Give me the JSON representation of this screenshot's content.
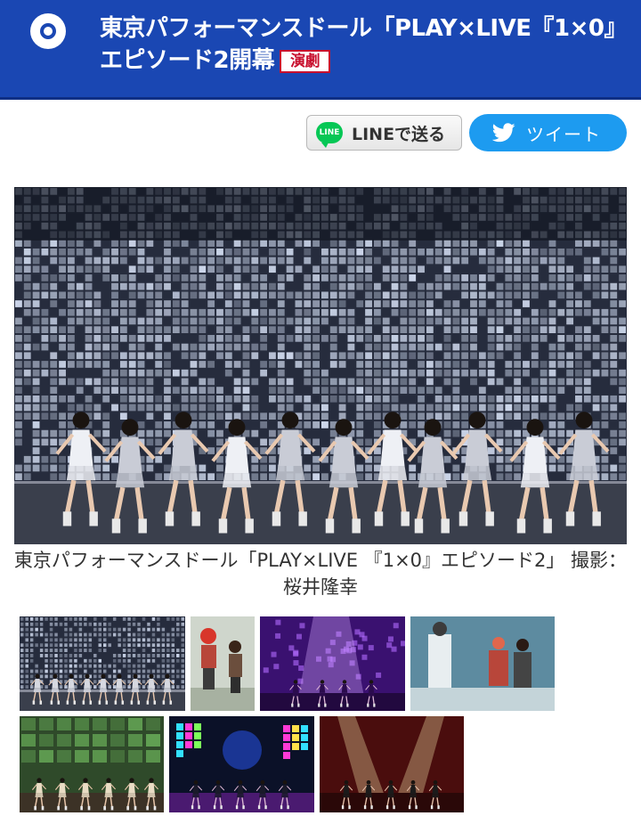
{
  "header": {
    "title": "東京パフォーマンスドール「PLAY×LIVE『1×0』エピソード2開幕",
    "category_badge": "演劇",
    "logo_icon": "site-logo-icon",
    "colors": {
      "bar": "#1a47b3",
      "badge": "#c8102e"
    }
  },
  "share": {
    "line_icon_text": "LINE",
    "line_label": "LINEで送る",
    "tweet_label": "ツイート",
    "line_icon": "line-icon",
    "tweet_icon": "twitter-bird-icon"
  },
  "main_photo": {
    "caption": "東京パフォーマンスドール「PLAY×LIVE 『1×0』エピソード2」 撮影：桜井隆幸"
  },
  "gallery": {
    "thumbnails": [
      {
        "scene": "projection-dance"
      },
      {
        "scene": "two-performers-red-hat"
      },
      {
        "scene": "purple-stage"
      },
      {
        "scene": "costumed-trio"
      },
      {
        "scene": "dancers-green-grid"
      },
      {
        "scene": "blue-logo-stage"
      },
      {
        "scene": "red-stage-lights"
      }
    ]
  }
}
